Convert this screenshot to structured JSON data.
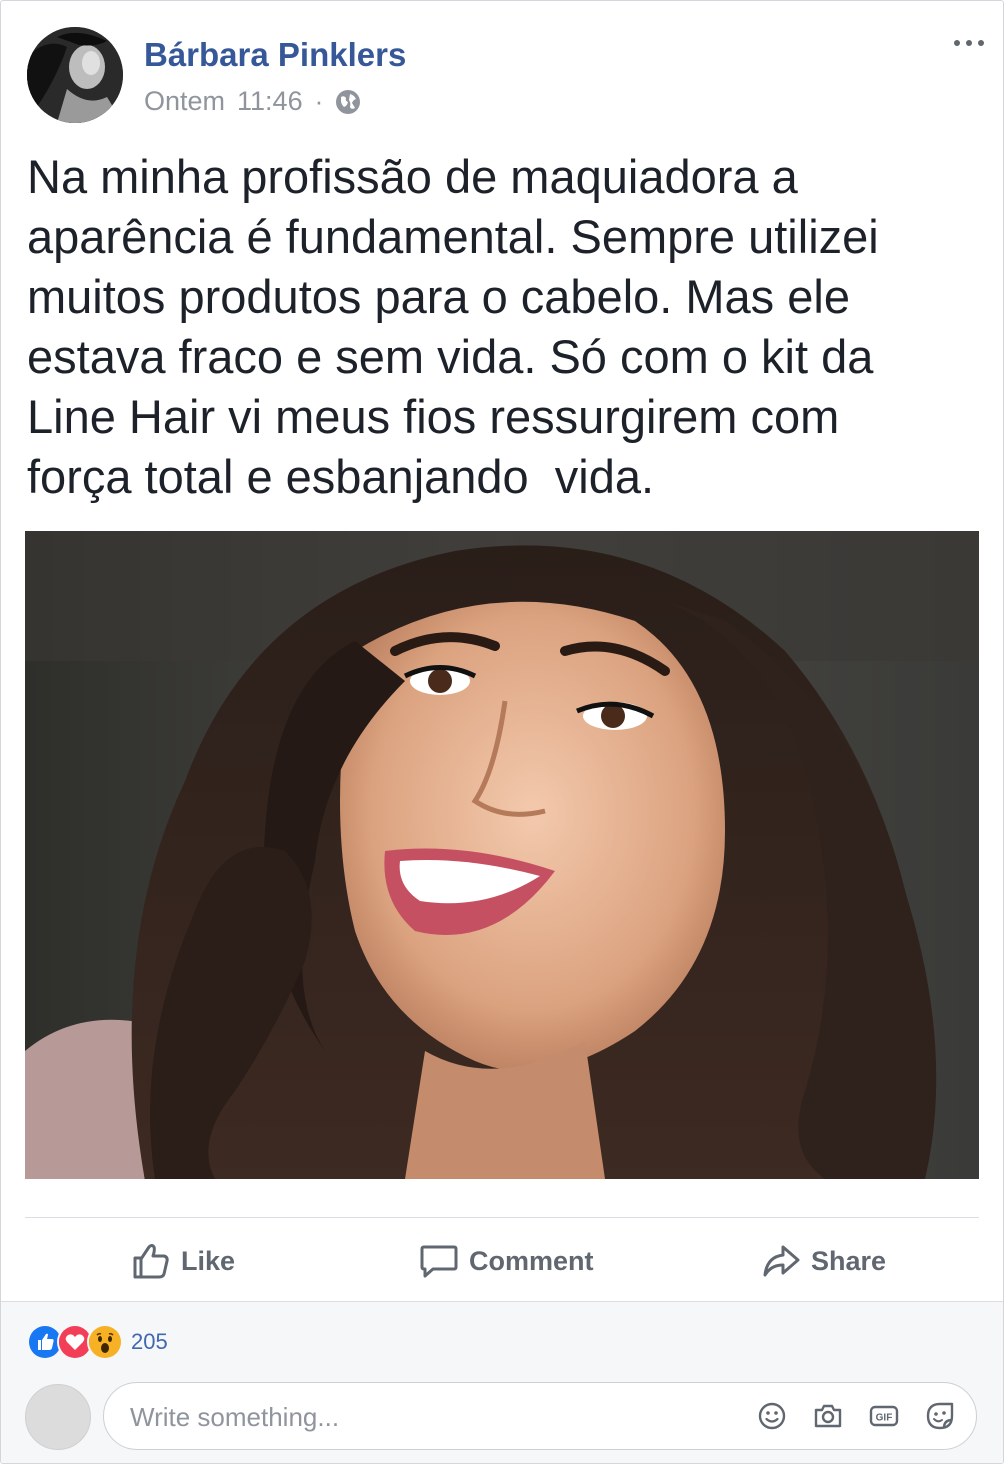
{
  "post": {
    "author": "Bárbara Pinklers",
    "date": "Ontem",
    "time": "11:46",
    "separator": "·",
    "privacy_icon": "globe-icon",
    "text": "Na minha profissão de maquiadora a\naparência é fundamental. Sempre utilizei\nmuitos produtos para o cabelo. Mas ele\nestava fraco e sem vida. Só com o kit da\nLine Hair vi meus fios ressurgirem com\nforça total e esbanjando  vida."
  },
  "actions": {
    "like_label": "Like",
    "comment_label": "Comment",
    "share_label": "Share"
  },
  "reactions": {
    "types": [
      "like",
      "love",
      "wow"
    ],
    "count": "205"
  },
  "comment": {
    "placeholder": "Write something...",
    "tools": [
      "emoji-icon",
      "camera-icon",
      "gif-icon",
      "sticker-icon"
    ]
  },
  "colors": {
    "author": "#365899",
    "meta": "#90949c",
    "text": "#1d2129",
    "action": "#606770",
    "like_blue": "#1877f2",
    "love_red": "#f33e58",
    "wow_yellow": "#f7b125",
    "count_blue": "#4267b2"
  }
}
